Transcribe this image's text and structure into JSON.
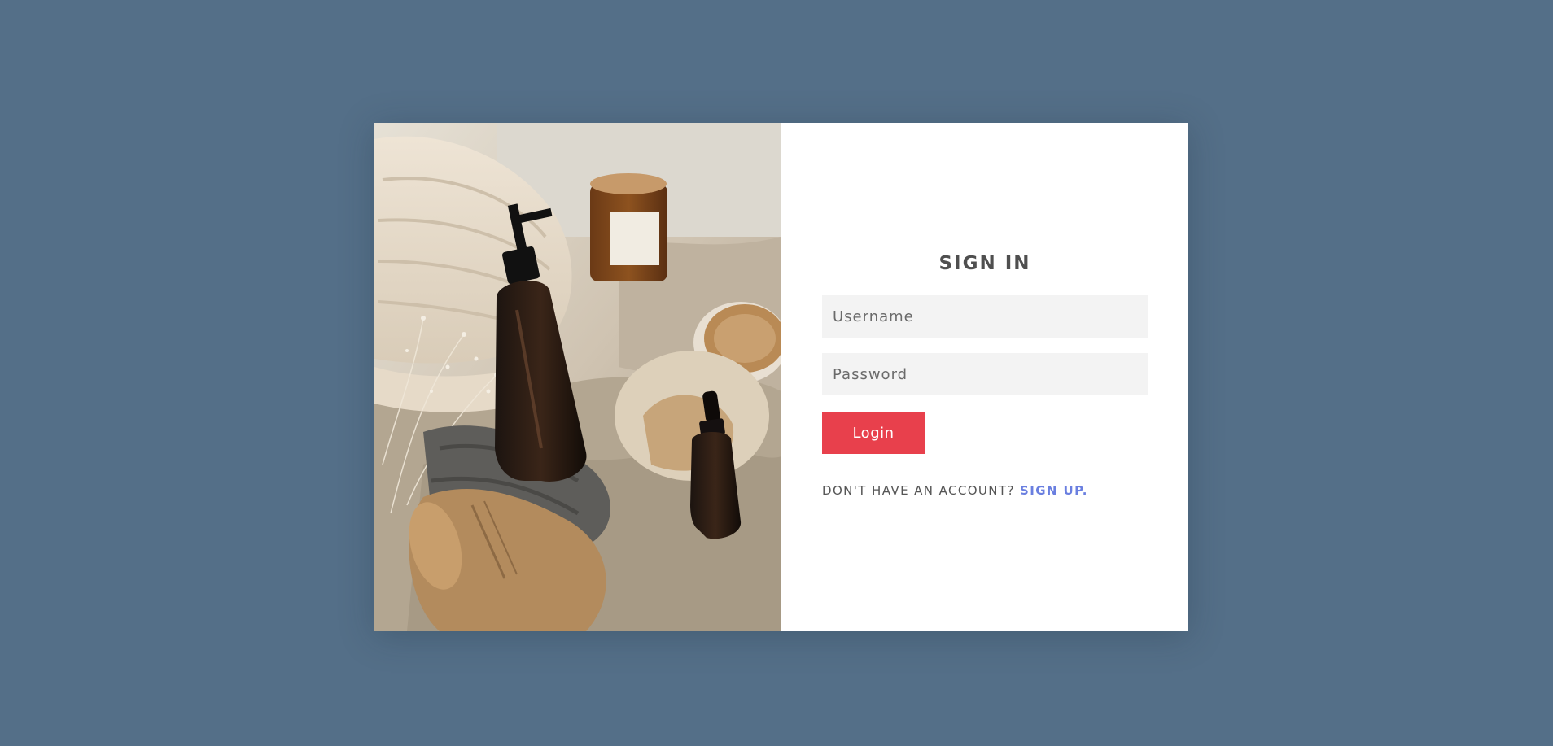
{
  "page": {
    "background_color": "#546f88"
  },
  "photo": {
    "icon": "spa-products-photo"
  },
  "form": {
    "title": "SIGN IN",
    "username_placeholder": "Username",
    "password_placeholder": "Password",
    "login_label": "Login",
    "no_account_text": "DON'T HAVE AN ACCOUNT?",
    "signup_label": "SIGN UP."
  },
  "colors": {
    "accent_button": "#e8404c",
    "link": "#6a7fe0",
    "field_bg": "#f3f3f3",
    "title_text": "#4f4f4f"
  }
}
